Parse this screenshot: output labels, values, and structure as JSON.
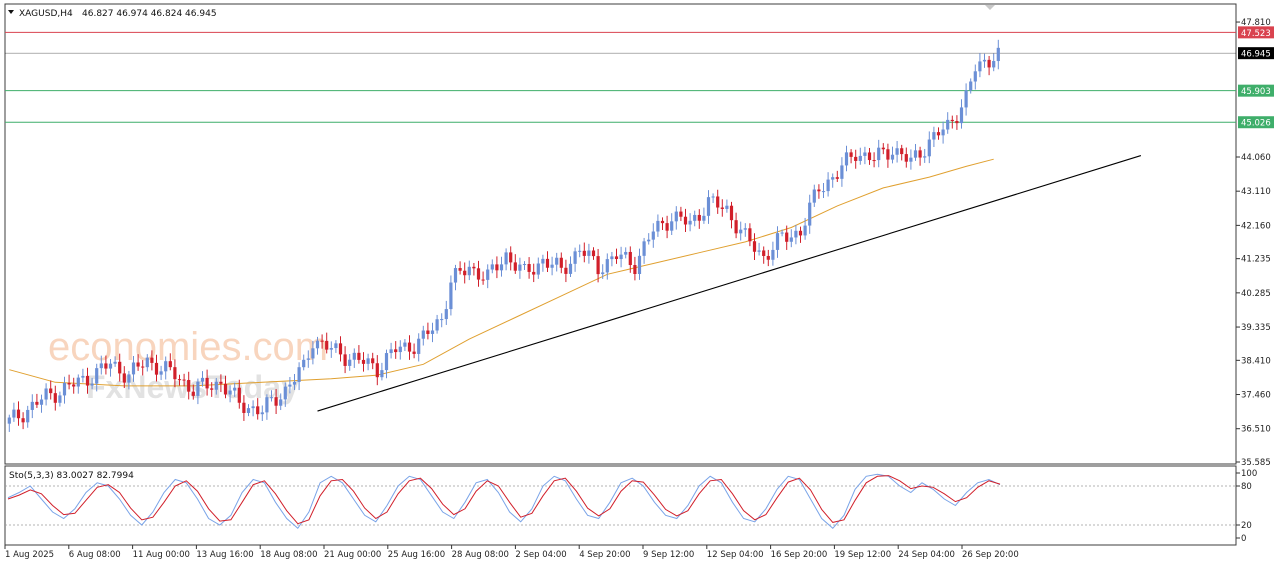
{
  "header": {
    "symbol": "XAGUSD,H4",
    "ohlc": "46.827 46.974 46.824 46.945"
  },
  "watermark": {
    "brand": "economies.com",
    "sub": "FxNewsToday"
  },
  "colors": {
    "bull": "#6b8fd6",
    "bear": "#d11f2a",
    "ma": "#e0a030",
    "trendline": "#000000",
    "resistance": "#d9434f",
    "support": "#3fae6a",
    "current": "#000000",
    "stoch_main": "#7aa4e8",
    "stoch_signal": "#d11f2a"
  },
  "chart_data": [
    {
      "type": "line",
      "title": "XAGUSD,H4",
      "ylim": [
        35.585,
        48.2
      ],
      "y_ticks": [
        "47.810",
        "44.060",
        "43.110",
        "42.160",
        "41.235",
        "40.285",
        "39.335",
        "38.410",
        "37.460",
        "36.510",
        "35.585"
      ],
      "x_ticks": [
        "1 Aug 2025",
        "6 Aug 08:00",
        "11 Aug 00:00",
        "13 Aug 16:00",
        "18 Aug 08:00",
        "21 Aug 00:00",
        "25 Aug 16:00",
        "28 Aug 08:00",
        "2 Sep 04:00",
        "4 Sep 20:00",
        "9 Sep 12:00",
        "12 Sep 04:00",
        "16 Sep 20:00",
        "19 Sep 12:00",
        "24 Sep 04:00",
        "26 Sep 20:00"
      ],
      "close_path": [
        [
          0,
          36.7
        ],
        [
          8,
          37.4
        ],
        [
          16,
          37.85
        ],
        [
          22,
          38.3
        ],
        [
          26,
          38.0
        ],
        [
          30,
          38.4
        ],
        [
          36,
          38.0
        ],
        [
          40,
          37.6
        ],
        [
          46,
          37.8
        ],
        [
          50,
          37.2
        ],
        [
          55,
          37.0
        ],
        [
          60,
          37.6
        ],
        [
          64,
          38.2
        ],
        [
          66,
          39.0
        ],
        [
          70,
          38.7
        ],
        [
          76,
          38.4
        ],
        [
          80,
          38.2
        ],
        [
          84,
          38.7
        ],
        [
          88,
          38.85
        ],
        [
          90,
          39.0
        ],
        [
          94,
          39.6
        ],
        [
          96,
          40.6
        ],
        [
          100,
          41.0
        ],
        [
          104,
          40.7
        ],
        [
          108,
          41.35
        ],
        [
          112,
          40.8
        ],
        [
          116,
          41.2
        ],
        [
          120,
          40.9
        ],
        [
          124,
          41.5
        ],
        [
          128,
          41.0
        ],
        [
          132,
          41.3
        ],
        [
          136,
          41.1
        ],
        [
          140,
          42.0
        ],
        [
          144,
          42.4
        ],
        [
          148,
          42.2
        ],
        [
          152,
          42.8
        ],
        [
          156,
          42.6
        ],
        [
          160,
          41.8
        ],
        [
          164,
          41.3
        ],
        [
          168,
          41.8
        ],
        [
          172,
          42.0
        ],
        [
          176,
          43.2
        ],
        [
          180,
          43.6
        ],
        [
          184,
          44.2
        ],
        [
          188,
          44.0
        ],
        [
          192,
          44.3
        ],
        [
          196,
          43.9
        ],
        [
          200,
          44.5
        ],
        [
          204,
          44.9
        ],
        [
          208,
          45.7
        ],
        [
          210,
          46.5
        ],
        [
          214,
          46.9
        ]
      ],
      "candle_count": 216,
      "ma_path": [
        [
          0,
          38.15
        ],
        [
          10,
          37.8
        ],
        [
          25,
          37.7
        ],
        [
          40,
          37.7
        ],
        [
          55,
          37.8
        ],
        [
          70,
          37.9
        ],
        [
          80,
          38.0
        ],
        [
          90,
          38.3
        ],
        [
          100,
          39.0
        ],
        [
          110,
          39.6
        ],
        [
          120,
          40.2
        ],
        [
          130,
          40.8
        ],
        [
          140,
          41.1
        ],
        [
          150,
          41.4
        ],
        [
          160,
          41.7
        ],
        [
          170,
          42.1
        ],
        [
          180,
          42.7
        ],
        [
          190,
          43.2
        ],
        [
          200,
          43.5
        ],
        [
          208,
          43.8
        ],
        [
          214,
          44.0
        ]
      ],
      "trendline": {
        "from": [
          67,
          37.0
        ],
        "to": [
          246,
          44.1
        ]
      },
      "levels": [
        {
          "name": "resistance",
          "value": "47.523",
          "color": "#d9434f",
          "style": "solid"
        },
        {
          "name": "current",
          "value": "46.945",
          "color": "#000000",
          "style": "solid"
        },
        {
          "name": "support-1",
          "value": "45.903",
          "color": "#3fae6a",
          "style": "solid"
        },
        {
          "name": "support-2",
          "value": "45.026",
          "color": "#3fae6a",
          "style": "solid"
        }
      ]
    },
    {
      "type": "line",
      "title": "Sto(5,3,3) 83.0027 82.7994",
      "ylim": [
        0,
        100
      ],
      "y_ticks": [
        "100",
        "80",
        "20",
        "0"
      ],
      "levels": [
        80,
        20
      ],
      "series": [
        {
          "name": "main",
          "values": [
            62,
            70,
            80,
            60,
            40,
            30,
            45,
            70,
            85,
            80,
            60,
            35,
            20,
            40,
            70,
            90,
            85,
            60,
            30,
            20,
            35,
            70,
            90,
            85,
            55,
            30,
            15,
            40,
            85,
            95,
            85,
            60,
            35,
            25,
            50,
            80,
            95,
            90,
            65,
            40,
            30,
            55,
            85,
            90,
            70,
            40,
            25,
            45,
            80,
            95,
            88,
            60,
            35,
            30,
            55,
            85,
            92,
            80,
            55,
            35,
            30,
            50,
            80,
            95,
            85,
            55,
            30,
            25,
            45,
            75,
            95,
            90,
            60,
            30,
            15,
            35,
            75,
            95,
            98,
            95,
            80,
            70,
            85,
            75,
            60,
            50,
            70,
            85,
            90,
            82
          ]
        },
        {
          "name": "signal",
          "values": [
            60,
            66,
            74,
            68,
            50,
            36,
            38,
            58,
            78,
            82,
            70,
            46,
            28,
            32,
            55,
            80,
            88,
            72,
            45,
            26,
            28,
            55,
            82,
            88,
            68,
            42,
            22,
            28,
            65,
            88,
            90,
            72,
            46,
            30,
            40,
            68,
            88,
            92,
            76,
            52,
            36,
            45,
            72,
            88,
            80,
            55,
            32,
            38,
            65,
            88,
            92,
            72,
            46,
            34,
            45,
            72,
            88,
            86,
            66,
            44,
            34,
            42,
            68,
            88,
            90,
            68,
            42,
            28,
            36,
            62,
            86,
            92,
            74,
            44,
            24,
            28,
            58,
            85,
            95,
            96,
            88,
            76,
            80,
            78,
            68,
            56,
            62,
            78,
            88,
            83
          ]
        }
      ]
    }
  ]
}
